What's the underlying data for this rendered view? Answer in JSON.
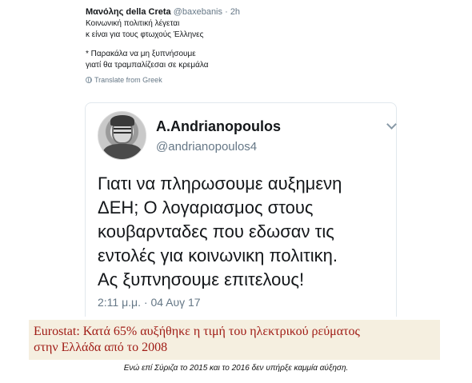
{
  "outer_tweet": {
    "name": "Μανόλης della Creta",
    "handle": "@baxebanis",
    "separator": "·",
    "time": "2h",
    "text_lines": [
      "Κοινωνική πολιτική λέγεται",
      "κ είναι για τους φτωχούς Έλληνες"
    ],
    "text_lines_2": [
      "* Παρακάλα να μη ξυπνήσουμε",
      "γιατί θα τραμπαλίζεσαι σε κρεμάλα"
    ],
    "translate_label": "Translate from Greek",
    "translate_icon": "globe-icon"
  },
  "quoted_tweet": {
    "name": "A.Andrianopoulos",
    "handle": "@andrianopoulos4",
    "menu_icon": "chevron-down-icon",
    "text_lines": [
      "Γιατι να πληρωσουμε αυξημενη",
      "ΔΕΗ;  Ο λογαριασμος στους",
      "κουβαρνταδες που εδωσαν τις",
      "εντολές για κοινωνικη πολιτικη.",
      "Ας ξυπνησουμε επιτελους!"
    ],
    "timestamp": "2:11 μ.μ. · 04 Αυγ 17"
  },
  "banner": {
    "lines": [
      "Eurostat: Κατά 65% αυξήθηκε η τιμή του ηλεκτρικού ρεύματος",
      "στην Ελλάδα από το 2008"
    ],
    "text_color": "#a01c16",
    "background_color": "#f5efe0"
  },
  "caption": "Ενώ επί Σύριζα το 2015 και το 2016 δεν υπήρξε καμμία αύξηση."
}
